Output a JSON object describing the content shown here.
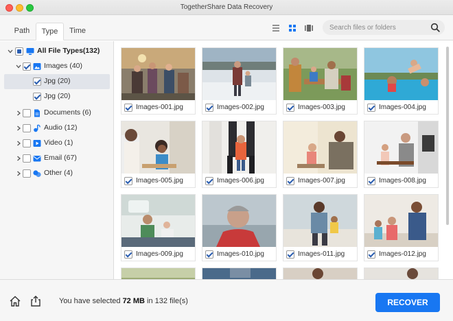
{
  "window": {
    "title": "TogetherShare Data Recovery"
  },
  "tabs": [
    {
      "label": "Path",
      "active": false
    },
    {
      "label": "Type",
      "active": true
    },
    {
      "label": "Time",
      "active": false
    }
  ],
  "view": {
    "mode": "grid"
  },
  "search": {
    "placeholder": "Search files or folders",
    "value": ""
  },
  "tree": [
    {
      "label": "All File Types(132)",
      "icon": "monitor-icon",
      "expanded": true,
      "checkbox": "partial",
      "selected": false
    },
    {
      "label": "Images (40)",
      "icon": "image-icon",
      "expanded": true,
      "checkbox": "checked",
      "selected": false
    },
    {
      "label": "Jpg (20)",
      "icon": "",
      "expanded": false,
      "checkbox": "checked",
      "selected": true
    },
    {
      "label": "Jpg (20)",
      "icon": "",
      "expanded": false,
      "checkbox": "checked",
      "selected": false
    },
    {
      "label": "Documents (6)",
      "icon": "document-icon",
      "expanded": false,
      "checkbox": "unchecked",
      "selected": false
    },
    {
      "label": "Audio (12)",
      "icon": "audio-icon",
      "expanded": false,
      "checkbox": "unchecked",
      "selected": false
    },
    {
      "label": "Video (1)",
      "icon": "video-icon",
      "expanded": false,
      "checkbox": "unchecked",
      "selected": false
    },
    {
      "label": "Email (67)",
      "icon": "email-icon",
      "expanded": false,
      "checkbox": "unchecked",
      "selected": false
    },
    {
      "label": "Other (4)",
      "icon": "other-icon",
      "expanded": false,
      "checkbox": "unchecked",
      "selected": false
    }
  ],
  "files": [
    {
      "name": "Images-001.jpg",
      "checked": true
    },
    {
      "name": "Images-002.jpg",
      "checked": true
    },
    {
      "name": "Images-003.jpg",
      "checked": true
    },
    {
      "name": "Images-004.jpg",
      "checked": true
    },
    {
      "name": "Images-005.jpg",
      "checked": true
    },
    {
      "name": "Images-006.jpg",
      "checked": true
    },
    {
      "name": "Images-007.jpg",
      "checked": true
    },
    {
      "name": "Images-008.jpg",
      "checked": true
    },
    {
      "name": "Images-009.jpg",
      "checked": true
    },
    {
      "name": "Images-010.jpg",
      "checked": true
    },
    {
      "name": "Images-011.jpg",
      "checked": true
    },
    {
      "name": "Images-012.jpg",
      "checked": true
    }
  ],
  "footer": {
    "status_prefix": "You have selected",
    "size": "72 MB",
    "status_mid": "in",
    "count": "132 file(s)",
    "recover_label": "RECOVER"
  },
  "colors": {
    "accent": "#1877f2",
    "checkmark": "#2a5db0",
    "sidebar_bg": "#f6f6f6",
    "selected_row": "#e1e4ea"
  }
}
